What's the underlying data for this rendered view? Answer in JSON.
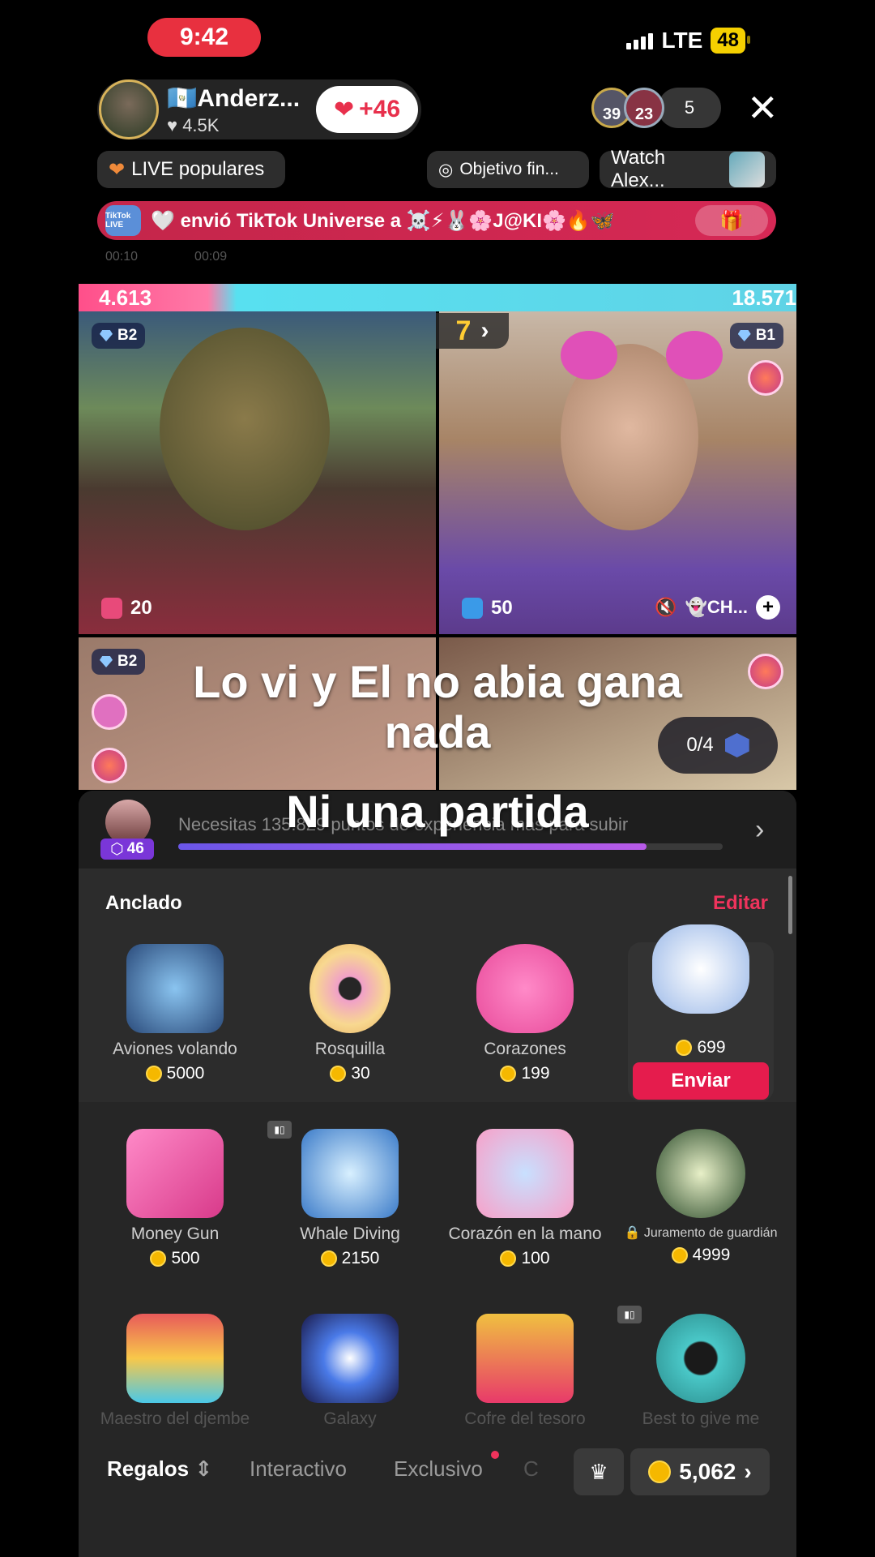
{
  "status": {
    "time": "9:42",
    "network": "LTE",
    "battery": "48"
  },
  "host": {
    "name": "Anderz...",
    "flag": "🇬🇹",
    "likes": "4.5K",
    "like_count": "+46"
  },
  "viewers": {
    "top1": "39",
    "top2": "23",
    "count": "5"
  },
  "chips": {
    "popular": "LIVE populares",
    "goal": "Objetivo fin...",
    "watch": "Watch Alex..."
  },
  "gift_banner": {
    "text": "envió TikTok Universe a ☠️⚡🐰🌸J@KI🌸🔥🦋",
    "logo": "TikTok LIVE"
  },
  "ghost_times": [
    "00:10",
    "00:09"
  ],
  "battle": {
    "left_score": "4.613",
    "right_score": "18.571",
    "round": "7"
  },
  "tiles": [
    {
      "badge": "B2",
      "score": "20"
    },
    {
      "badge": "B1",
      "score": "50",
      "user": "👻CH..."
    },
    {
      "badge": "B2"
    }
  ],
  "goal": {
    "progress": "0/4"
  },
  "caption": {
    "line1": "Lo vi y El no abia gana",
    "line2": "nada",
    "line3": "Ni una partida"
  },
  "level": {
    "badge": "46",
    "text": "Necesitas 135.829 puntos de experiencia más para subir",
    "progress": 0.86
  },
  "pinned": {
    "title": "Anclado",
    "edit": "Editar"
  },
  "gifts_pinned": [
    {
      "name": "Aviones volando",
      "price": "5000"
    },
    {
      "name": "Rosquilla",
      "price": "30"
    },
    {
      "name": "Corazones",
      "price": "199"
    },
    {
      "price": "699",
      "send": "Enviar"
    }
  ],
  "gifts_row2": [
    {
      "name": "Money Gun",
      "price": "500"
    },
    {
      "name": "Whale Diving",
      "price": "2150"
    },
    {
      "name": "Corazón en la mano",
      "price": "100"
    },
    {
      "name": "Juramento de guardián",
      "price": "4999"
    }
  ],
  "gifts_row3": [
    {
      "name": "Maestro del djembe"
    },
    {
      "name": "Galaxy"
    },
    {
      "name": "Cofre del tesoro"
    },
    {
      "name": "Best to give me"
    }
  ],
  "tabs": {
    "regalos": "Regalos",
    "interactivo": "Interactivo",
    "exclusivo": "Exclusivo",
    "more": "C"
  },
  "balance": "5,062",
  "colors": {
    "accent": "#e51c4d",
    "coin": "#f5b800",
    "battle_left": "#ff4f8a",
    "battle_right": "#5fd3e6"
  }
}
